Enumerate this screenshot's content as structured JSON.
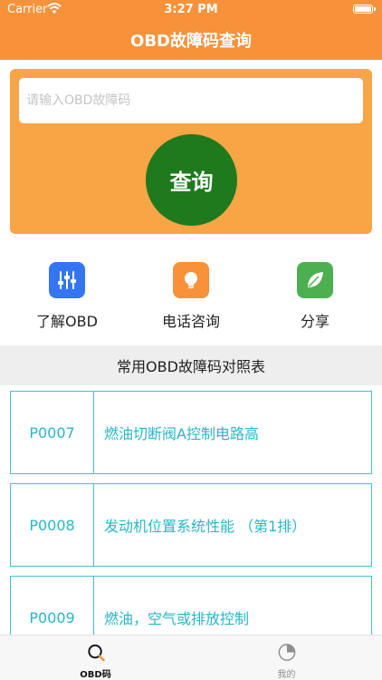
{
  "status_bar": {
    "carrier": "Carrier",
    "time": "3:27 PM",
    "battery_level": 1.0
  },
  "nav": {
    "title": "OBD故障码查询"
  },
  "search": {
    "placeholder": "请输入OBD故障码",
    "value": "",
    "button_label": "查询"
  },
  "actions": [
    {
      "label": "了解OBD",
      "icon": "sliders-icon",
      "color": "#3476f2"
    },
    {
      "label": "电话咨询",
      "icon": "lightbulb-icon",
      "color": "#f7923a"
    },
    {
      "label": "分享",
      "icon": "leaf-icon",
      "color": "#4caf50"
    }
  ],
  "section": {
    "title": "常用OBD故障码对照表"
  },
  "codes": [
    {
      "code": "P0007",
      "desc": "燃油切断阀A控制电路高"
    },
    {
      "code": "P0008",
      "desc": "发动机位置系统性能 （第1排）"
    },
    {
      "code": "P0009",
      "desc": "燃油，空气或排放控制"
    }
  ],
  "tabs": [
    {
      "label": "OBD码",
      "icon": "search-icon",
      "active": true
    },
    {
      "label": "我的",
      "icon": "pie-chart-icon",
      "active": false
    }
  ],
  "colors": {
    "header": "#f7923a",
    "search_card": "#f8a545",
    "search_button": "#1e7a1c",
    "code_text": "#29b6c6",
    "code_border": "#3ec3d1"
  }
}
